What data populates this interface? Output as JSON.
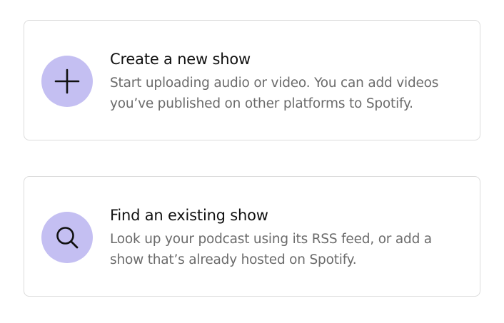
{
  "options": [
    {
      "title": "Create a new show",
      "description": "Start uploading audio or video. You can add videos you’ve published on other platforms to Spotify.",
      "icon": "plus-icon"
    },
    {
      "title": "Find an existing show",
      "description": "Look up your podcast using its RSS feed, or add a show that’s already hosted on Spotify.",
      "icon": "search-icon"
    }
  ],
  "colors": {
    "icon_background": "#c4bff2",
    "title": "#111111",
    "description": "#6b6b6b",
    "card_border": "#dcdcdc"
  }
}
